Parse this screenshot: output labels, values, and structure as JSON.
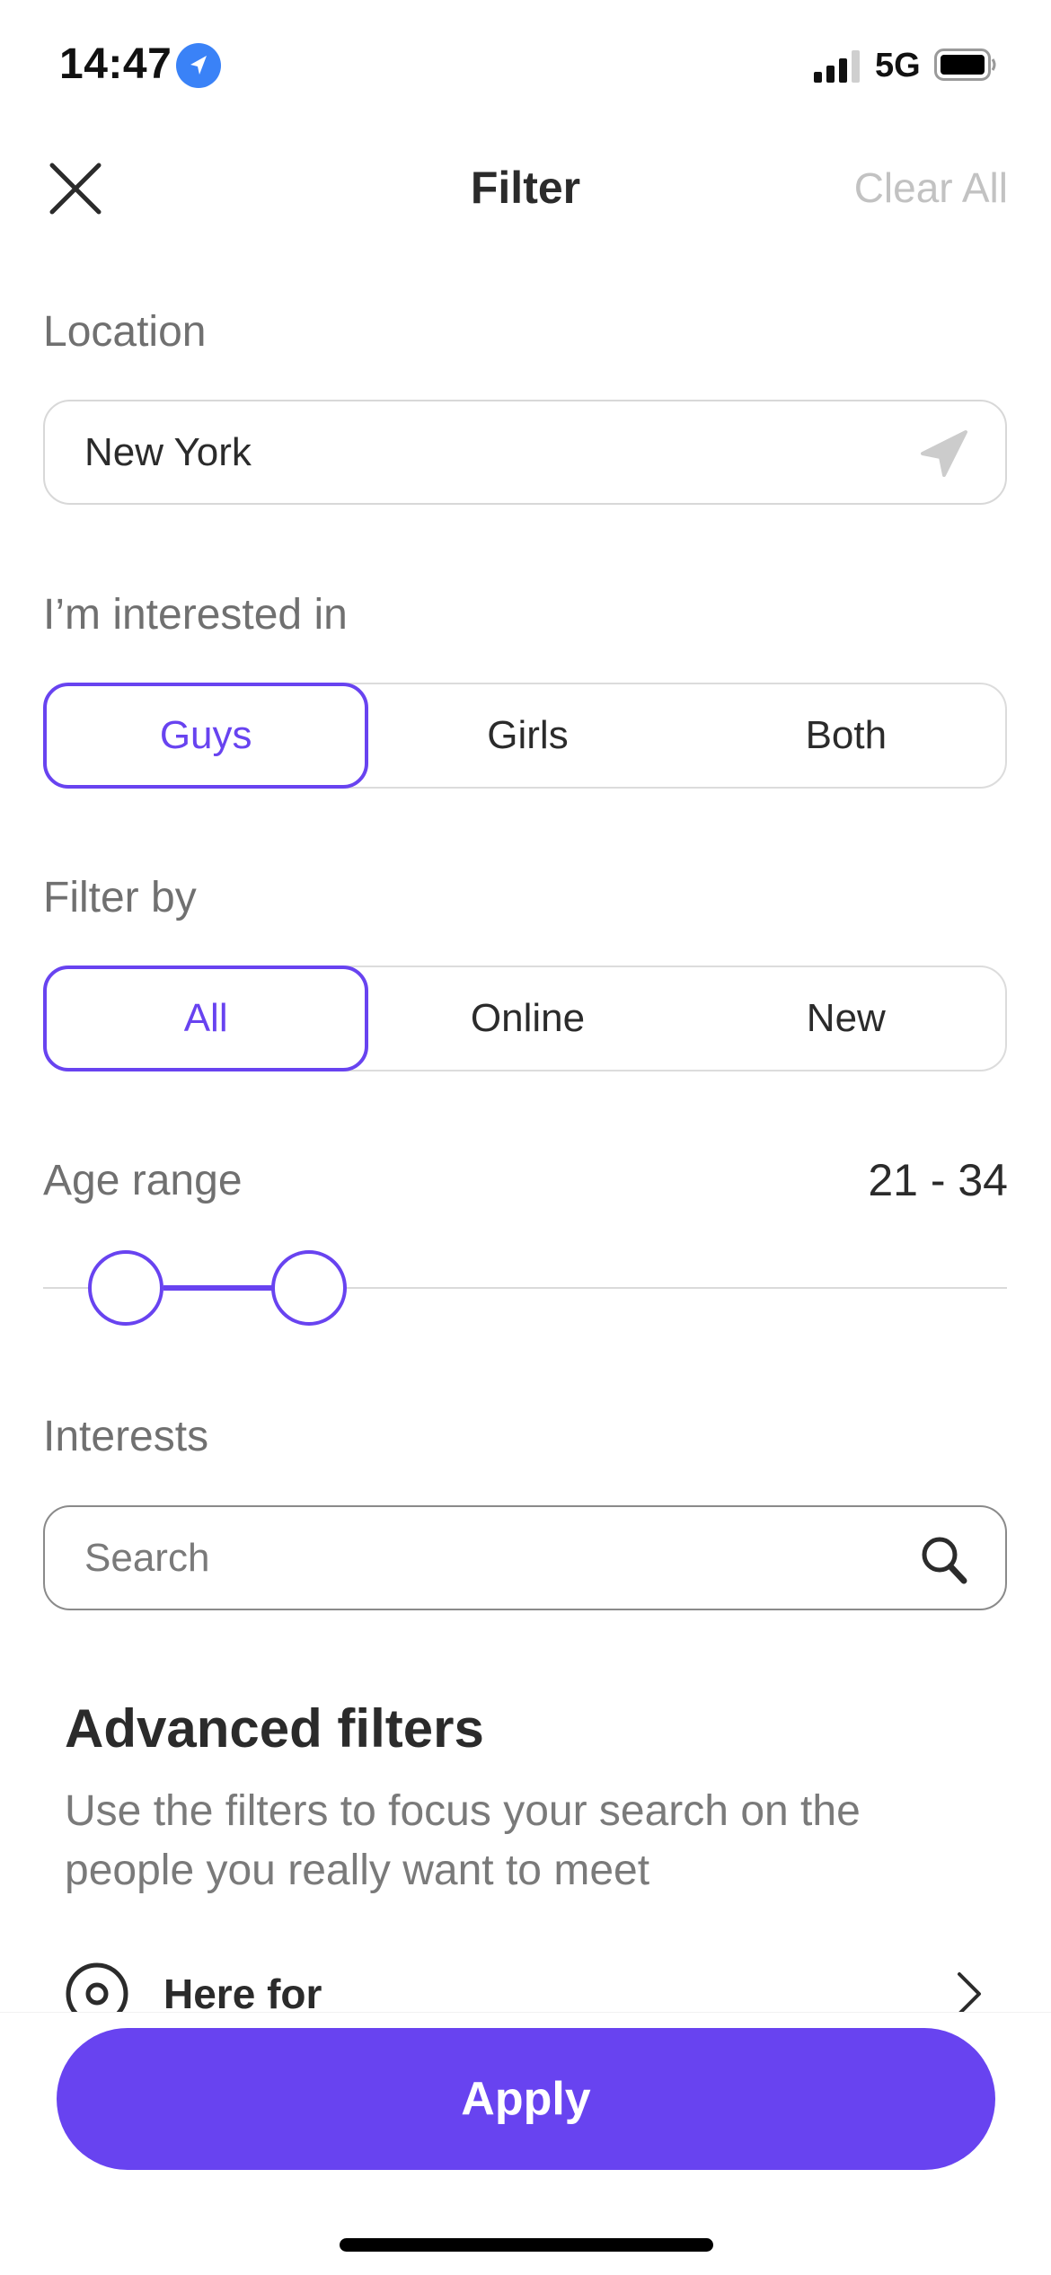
{
  "status_bar": {
    "time": "14:47",
    "network": "5G",
    "location_icon": "location-arrow-icon",
    "signal_icon": "cellular-signal-icon",
    "battery_icon": "battery-icon"
  },
  "header": {
    "title": "Filter",
    "close_icon": "close-icon",
    "clear_all_label": "Clear All"
  },
  "location": {
    "label": "Location",
    "value": "New York",
    "icon": "location-arrow-icon"
  },
  "interested_in": {
    "label": "I’m interested in",
    "options": [
      "Guys",
      "Girls",
      "Both"
    ],
    "selected": "Guys"
  },
  "filter_by": {
    "label": "Filter by",
    "options": [
      "All",
      "Online",
      "New"
    ],
    "selected": "All"
  },
  "age_range": {
    "label": "Age range",
    "value_text": "21 - 34",
    "min_selected": 21,
    "max_selected": 34
  },
  "interests": {
    "label": "Interests",
    "placeholder": "Search",
    "icon": "search-icon"
  },
  "advanced": {
    "title": "Advanced filters",
    "description": "Use the filters to focus your search on the people you really want to meet",
    "rows": [
      {
        "label": "Here for",
        "icon": "target-icon"
      }
    ]
  },
  "footer": {
    "apply_label": "Apply"
  },
  "colors": {
    "accent": "#6843f0",
    "location_blue": "#3a82f7",
    "label_gray": "#707070",
    "muted_gray": "#c2c2c2",
    "text_dark": "#2b2b2b"
  }
}
